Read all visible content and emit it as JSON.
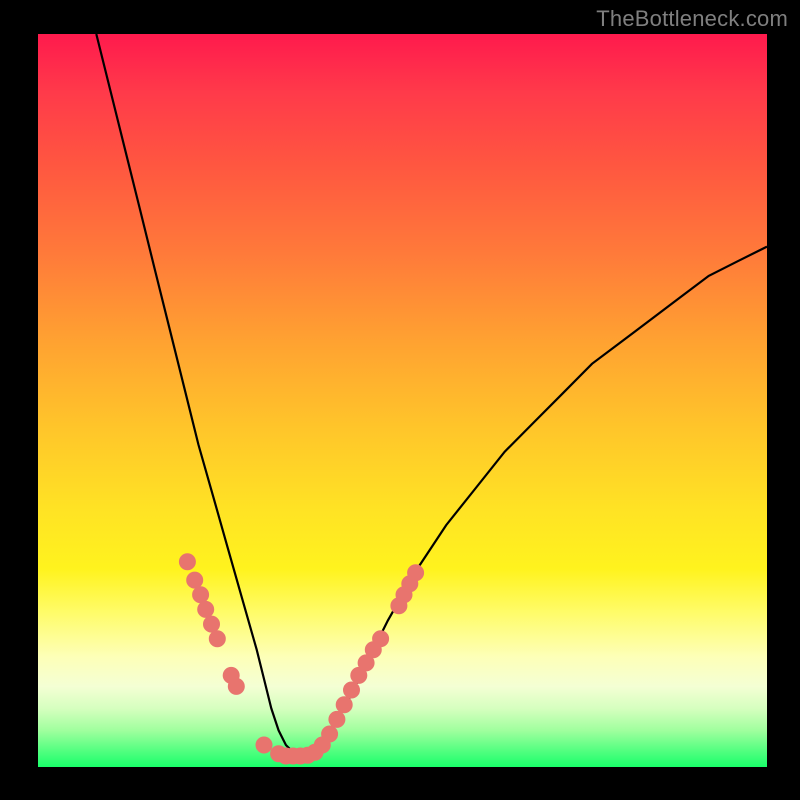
{
  "watermark": {
    "text": "TheBottleneck.com"
  },
  "colors": {
    "curve": "#000000",
    "marker_fill": "#e8746e",
    "marker_stroke": "#e8746e"
  },
  "chart_data": {
    "type": "line",
    "title": "",
    "xlabel": "",
    "ylabel": "",
    "xlim": [
      0,
      100
    ],
    "ylim": [
      0,
      100
    ],
    "grid": false,
    "legend": false,
    "series": [
      {
        "name": "bottleneck-curve",
        "x": [
          8,
          10,
          12,
          14,
          16,
          18,
          20,
          22,
          24,
          26,
          28,
          30,
          31,
          32,
          33,
          34,
          35,
          36,
          37,
          38,
          40,
          42,
          44,
          46,
          48,
          52,
          56,
          60,
          64,
          68,
          72,
          76,
          80,
          84,
          88,
          92,
          96,
          100
        ],
        "y": [
          100,
          92,
          84,
          76,
          68,
          60,
          52,
          44,
          37,
          30,
          23,
          16,
          12,
          8,
          5,
          3,
          2,
          2,
          2,
          3,
          5,
          8,
          12,
          16,
          20,
          27,
          33,
          38,
          43,
          47,
          51,
          55,
          58,
          61,
          64,
          67,
          69,
          71
        ]
      }
    ],
    "markers": [
      {
        "x": 20.5,
        "y": 28
      },
      {
        "x": 21.5,
        "y": 25.5
      },
      {
        "x": 22.3,
        "y": 23.5
      },
      {
        "x": 23.0,
        "y": 21.5
      },
      {
        "x": 23.8,
        "y": 19.5
      },
      {
        "x": 24.6,
        "y": 17.5
      },
      {
        "x": 26.5,
        "y": 12.5
      },
      {
        "x": 27.2,
        "y": 11
      },
      {
        "x": 31.0,
        "y": 3.0
      },
      {
        "x": 33.0,
        "y": 1.8
      },
      {
        "x": 34.0,
        "y": 1.5
      },
      {
        "x": 35.0,
        "y": 1.5
      },
      {
        "x": 36.0,
        "y": 1.5
      },
      {
        "x": 37.0,
        "y": 1.6
      },
      {
        "x": 38.0,
        "y": 2.0
      },
      {
        "x": 39.0,
        "y": 3.0
      },
      {
        "x": 40.0,
        "y": 4.5
      },
      {
        "x": 41.0,
        "y": 6.5
      },
      {
        "x": 42.0,
        "y": 8.5
      },
      {
        "x": 43.0,
        "y": 10.5
      },
      {
        "x": 44.0,
        "y": 12.5
      },
      {
        "x": 45.0,
        "y": 14.2
      },
      {
        "x": 46.0,
        "y": 16.0
      },
      {
        "x": 47.0,
        "y": 17.5
      },
      {
        "x": 49.5,
        "y": 22.0
      },
      {
        "x": 50.2,
        "y": 23.5
      },
      {
        "x": 51.0,
        "y": 25.0
      },
      {
        "x": 51.8,
        "y": 26.5
      }
    ],
    "marker_radius_units": 1.1
  }
}
